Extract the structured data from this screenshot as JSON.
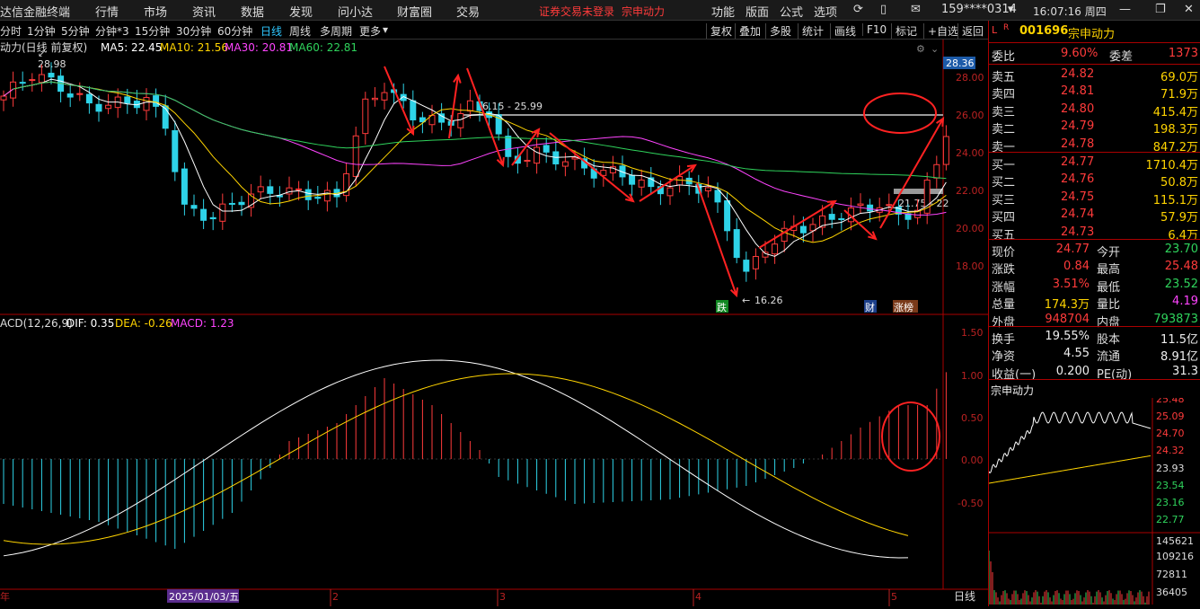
{
  "app": {
    "brand": "达信金融终端",
    "menu": [
      "行情",
      "市场",
      "资讯",
      "数据",
      "发现",
      "问小达",
      "财富圈",
      "交易"
    ],
    "notice": "证券交易未登录",
    "stock_link": "宗申动力",
    "right_menu": [
      "功能",
      "版面",
      "公式",
      "选项"
    ],
    "user": "159****0314",
    "clock": "16:07:16 周四"
  },
  "toolbar": {
    "periods": [
      "分时",
      "1分钟",
      "5分钟",
      "分钟*3",
      "15分钟",
      "30分钟",
      "60分钟",
      "日线",
      "周线",
      "多周期",
      "更多"
    ],
    "active": "日线",
    "buttons": [
      "复权",
      "叠加",
      "多股",
      "统计",
      "画线",
      "F10",
      "标记",
      "+自选",
      "返回"
    ]
  },
  "kline": {
    "title": "动力(日线 前复权)",
    "ma_labels": [
      "MA5: 22.45",
      "MA10: 21.56",
      "MA30: 20.81",
      "MA60: 22.81"
    ],
    "ma_colors": [
      "#ffffff",
      "#ffd400",
      "#ff44ff",
      "#2fd35c"
    ],
    "y_ticks": [
      "28.00",
      "26.00",
      "24.00",
      "22.00",
      "20.00",
      "18.00"
    ],
    "current_price": "28.36",
    "high_label": "28.98",
    "low_label": "16.26",
    "zone1": "26.15 - 25.99",
    "zone2": "21.75 - 22",
    "markers": [
      "跌",
      "财",
      "涨榜"
    ]
  },
  "macd": {
    "title": "ACD(12,26,9)",
    "dif": "DIF: 0.35",
    "dea": "DEA: -0.26",
    "macd": "MACD: 1.23",
    "y_ticks": [
      "1.50",
      "1.00",
      "0.50",
      "0.00",
      "-0.50"
    ]
  },
  "xaxis": {
    "labels": [
      "年",
      "2025/01/03/五",
      "2",
      "3",
      "4",
      "5"
    ],
    "period": "日线"
  },
  "quote": {
    "code": "001696",
    "name": "宗申动力",
    "ratio": {
      "label": "委比",
      "value": "9.60%",
      "label2": "委差",
      "value2": "1373"
    },
    "asks": [
      {
        "label": "卖五",
        "price": "24.82",
        "vol": "69.0万"
      },
      {
        "label": "卖四",
        "price": "24.81",
        "vol": "71.9万"
      },
      {
        "label": "卖三",
        "price": "24.80",
        "vol": "415.4万"
      },
      {
        "label": "卖二",
        "price": "24.79",
        "vol": "198.3万"
      },
      {
        "label": "卖一",
        "price": "24.78",
        "vol": "847.2万"
      }
    ],
    "bids": [
      {
        "label": "买一",
        "price": "24.77",
        "vol": "1710.4万"
      },
      {
        "label": "买二",
        "price": "24.76",
        "vol": "50.8万"
      },
      {
        "label": "买三",
        "price": "24.75",
        "vol": "115.1万"
      },
      {
        "label": "买四",
        "price": "24.74",
        "vol": "57.9万"
      },
      {
        "label": "买五",
        "price": "24.73",
        "vol": "6.4万"
      }
    ],
    "stats": [
      [
        "现价",
        "24.77",
        "今开",
        "23.70"
      ],
      [
        "涨跌",
        "0.84",
        "最高",
        "25.48"
      ],
      [
        "涨幅",
        "3.51%",
        "最低",
        "23.52"
      ],
      [
        "总量",
        "174.3万",
        "量比",
        "4.19"
      ],
      [
        "外盘",
        "948704",
        "内盘",
        "793873"
      ]
    ],
    "stats2": [
      [
        "换手",
        "19.55%",
        "股本",
        "11.5亿"
      ],
      [
        "净资",
        "4.55",
        "流通",
        "8.91亿"
      ],
      [
        "收益(一)",
        "0.200",
        "PE(动)",
        "31.3"
      ]
    ]
  },
  "intraday": {
    "title": "宗申动力",
    "price_ticks": [
      "25.48",
      "25.09",
      "24.70",
      "24.32",
      "23.93",
      "23.54",
      "23.16",
      "22.77"
    ],
    "vol_ticks": [
      "145621",
      "109216",
      "72811",
      "36405"
    ]
  }
}
